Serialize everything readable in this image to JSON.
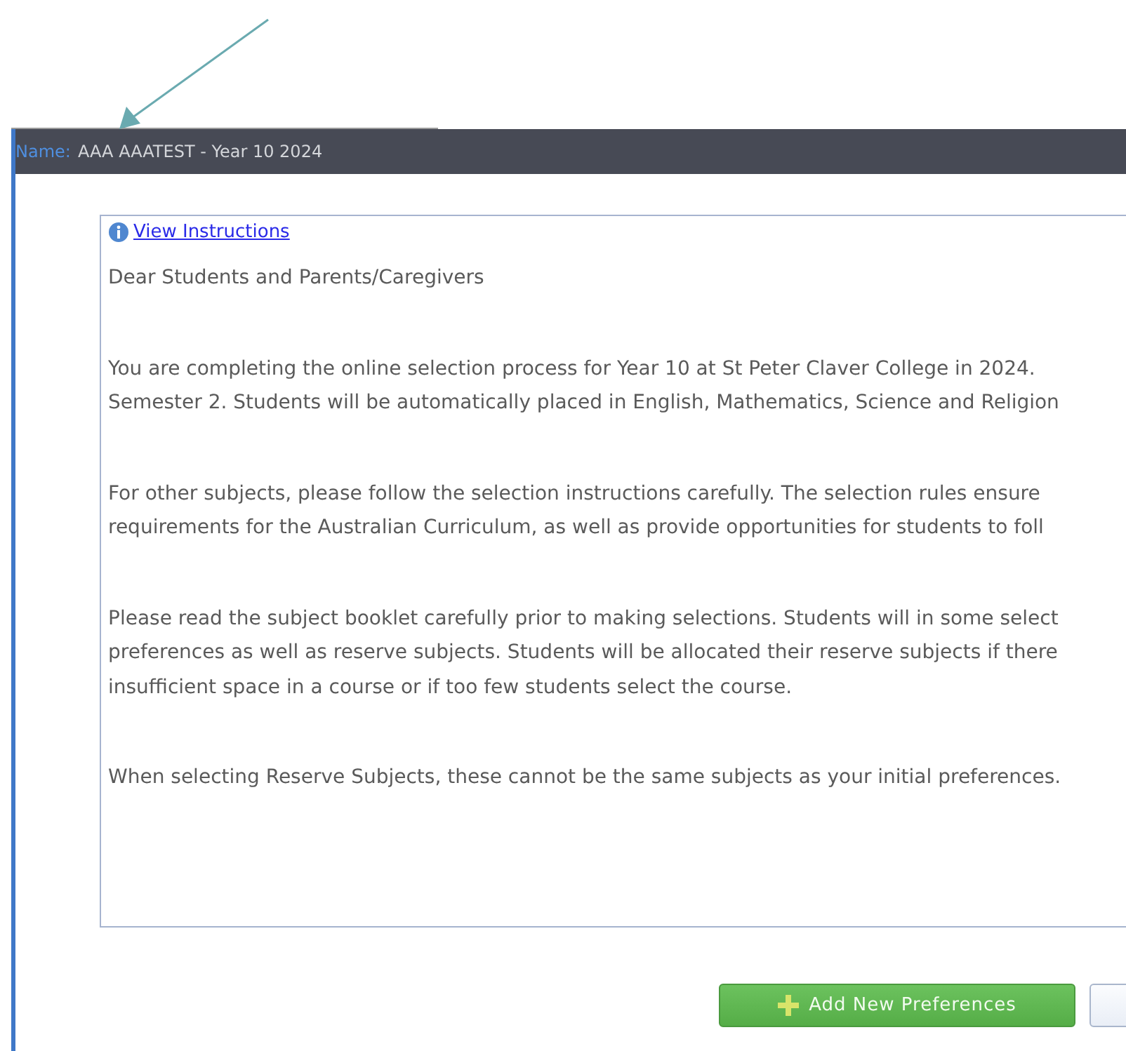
{
  "window": {
    "title_label": "Name:",
    "title": "AAA AAATEST - Year 10 2024"
  },
  "instructions": {
    "link": "View Instructions",
    "paragraphs": [
      [
        "Dear Students and Parents/Caregivers"
      ],
      [
        "You are completing the online selection process for Year 10 at St Peter Claver College in 2024.",
        "Semester 2. Students will be automatically placed in English, Mathematics, Science and Religion"
      ],
      [
        "For other subjects, please follow the selection instructions carefully. The selection rules ensure",
        "requirements for the Australian Curriculum, as well as provide opportunities for students to foll"
      ],
      [
        "Please read the subject booklet carefully prior to making selections. Students will in some select",
        "preferences as well as reserve subjects. Students will be allocated their reserve subjects if there",
        "insufficient space in a course or if too few students select the course."
      ],
      [
        "When selecting Reserve Subjects, these cannot be the same subjects as your initial preferences."
      ]
    ]
  },
  "buttons": [
    {
      "kind": "add",
      "label": "Add New Preferences"
    },
    {
      "kind": "plain"
    }
  ]
}
